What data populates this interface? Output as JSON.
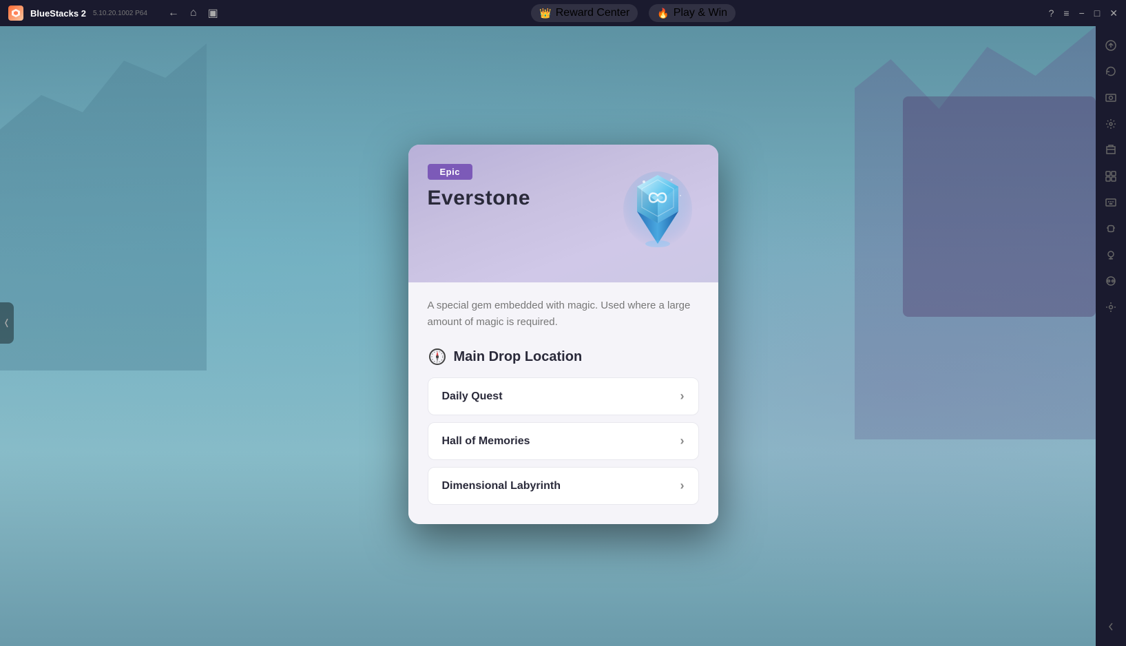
{
  "titlebar": {
    "app_name": "BlueStacks 2",
    "version": "5.10.20.1002  P64",
    "reward_center_label": "Reward Center",
    "play_and_win_label": "Play & Win"
  },
  "card": {
    "rarity_badge": "Epic",
    "item_name": "Everstone",
    "description": "A special gem embedded with magic. Used where a large amount of magic is required.",
    "drop_section_title": "Main Drop Location",
    "locations": [
      {
        "name": "Daily Quest"
      },
      {
        "name": "Hall of Memories"
      },
      {
        "name": "Dimensional Labyrinth"
      }
    ]
  },
  "right_sidebar": {
    "icons": [
      "home",
      "refresh",
      "camera",
      "settings",
      "folder",
      "power",
      "keyboard",
      "volume",
      "location",
      "gamepad",
      "settings2",
      "arrow-left"
    ]
  }
}
